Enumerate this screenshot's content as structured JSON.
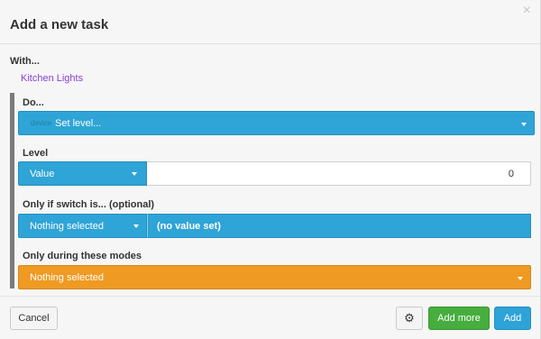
{
  "dialog": {
    "title": "Add a new task",
    "close_icon": "close-icon",
    "close_glyph": "×"
  },
  "with": {
    "label": "With...",
    "device": "Kitchen Lights"
  },
  "do": {
    "label": "Do...",
    "prefix": "device",
    "selected": "Set level..."
  },
  "level": {
    "label": "Level",
    "type_selected": "Value",
    "value": "0"
  },
  "switch": {
    "label": "Only if switch is... (optional)",
    "selected": "Nothing selected",
    "value_text": "(no value set)"
  },
  "modes": {
    "label": "Only during these modes",
    "selected": "Nothing selected"
  },
  "footer": {
    "cancel_label": "Cancel",
    "gear_icon": "gear-icon",
    "gear_glyph": "⚙",
    "add_more_label": "Add more",
    "add_label": "Add"
  },
  "colors": {
    "blue": "#2fa4d6",
    "orange": "#ef9a23",
    "green": "#46ad3e",
    "device_link": "#8a3fd6"
  }
}
